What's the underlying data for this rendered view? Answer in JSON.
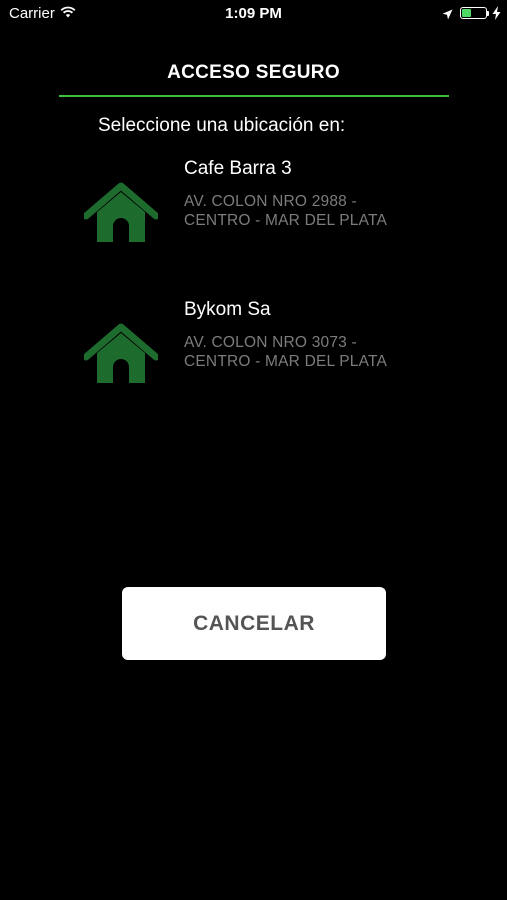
{
  "status_bar": {
    "carrier": "Carrier",
    "time": "1:09 PM",
    "battery_level_percent": 40,
    "icons": [
      "wifi-icon",
      "location-arrow-icon",
      "battery-icon",
      "charging-bolt-icon"
    ]
  },
  "header": {
    "title": "ACCESO SEGURO",
    "accent_color": "#3dbd3d"
  },
  "subtitle": "Seleccione una ubicación en:",
  "locations": [
    {
      "name": "Cafe Barra 3",
      "address_line1": "AV. COLON NRO 2988 -",
      "address_line2": "CENTRO - MAR DEL PLATA",
      "icon": "house-icon",
      "icon_color": "#1e6b2e"
    },
    {
      "name": "Bykom Sa",
      "address_line1": "AV. COLON NRO 3073 -",
      "address_line2": "CENTRO - MAR DEL PLATA",
      "icon": "house-icon",
      "icon_color": "#1e6b2e"
    }
  ],
  "cancel_button": {
    "label": "CANCELAR"
  }
}
